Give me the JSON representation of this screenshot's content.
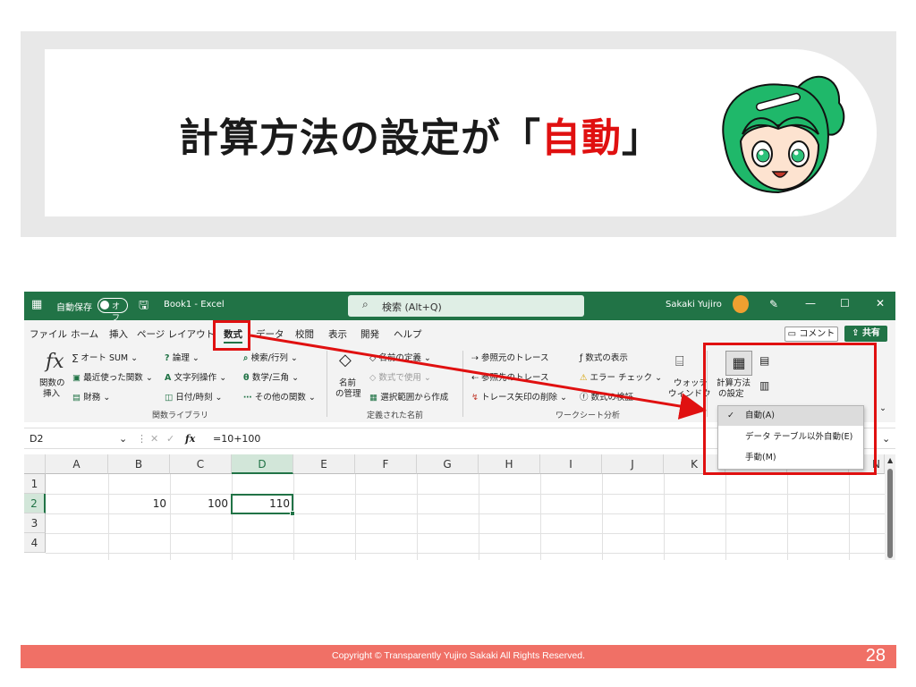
{
  "slide": {
    "title_prefix": "計算方法の設定が「",
    "title_highlight": "自動",
    "title_suffix": "」",
    "footer_copyright": "Copyright © Transparently  Yujiro Sakaki   All Rights Reserved.",
    "page_number": "28"
  },
  "excel": {
    "autosave_label": "自動保存",
    "autosave_state": "オフ",
    "doc_title": "Book1 - Excel",
    "search_placeholder": "検索 (Alt+Q)",
    "user_name": "Sakaki Yujiro",
    "menu": [
      "ファイル",
      "ホーム",
      "挿入",
      "ページ レイアウト",
      "数式",
      "データ",
      "校閲",
      "表示",
      "開発",
      "ヘルプ"
    ],
    "comment_label": "コメント",
    "share_label": "共有",
    "ribbon": {
      "insert_function": [
        "関数の",
        "挿入"
      ],
      "autosum": "オート SUM",
      "recent": "最近使った関数",
      "financial": "財務",
      "logical": "論理",
      "text": "文字列操作",
      "datetime": "日付/時刻",
      "lookup": "検索/行列",
      "math": "数学/三角",
      "more": "その他の関数",
      "group_library": "関数ライブラリ",
      "name_manager": [
        "名前",
        "の管理"
      ],
      "define_name": "名前の定義",
      "use_in_formula": "数式で使用",
      "create_from_selection": "選択範囲から作成",
      "group_names": "定義された名前",
      "trace_precedents": "参照元のトレース",
      "trace_dependents": "参照先のトレース",
      "remove_arrows": "トレース矢印の削除",
      "show_formulas": "数式の表示",
      "error_checking": "エラー チェック",
      "evaluate_formula": "数式の検証",
      "group_auditing": "ワークシート分析",
      "watch_window": [
        "ウォッチ",
        "ウィンドウ"
      ],
      "calc_options": [
        "計算方法",
        "の設定"
      ]
    },
    "name_box": "D2",
    "formula": "=10+100",
    "columns": [
      "A",
      "B",
      "C",
      "D",
      "E",
      "F",
      "G",
      "H",
      "I",
      "J",
      "K",
      "N"
    ],
    "rows": [
      "1",
      "2",
      "3",
      "4"
    ],
    "cells": {
      "B2": "10",
      "C2": "100",
      "D2": "110"
    },
    "calc_menu": [
      {
        "label": "自動(A)",
        "checked": true
      },
      {
        "label": "データ テーブル以外自動(E)",
        "checked": false
      },
      {
        "label": "手動(M)",
        "checked": false
      }
    ]
  },
  "colors": {
    "excel_green": "#217346",
    "highlight_red": "#e01010",
    "footer_bg": "#f07066",
    "band_gray": "#e8e8e8"
  }
}
